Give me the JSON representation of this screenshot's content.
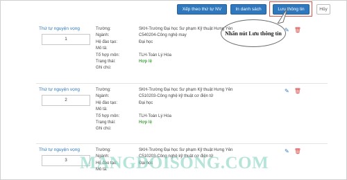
{
  "toolbar": {
    "sort_label": "Xếp theo thứ tự NV",
    "print_label": "In danh sách",
    "save_label": "Lưu thông tin",
    "cancel_label": "Hủy"
  },
  "callout": {
    "text": "Nhấn nút Lưu thông tin"
  },
  "field_labels": {
    "school": "Trường:",
    "major": "Ngành:",
    "training": "Hệ đào tạo:",
    "desc": "Mô tả:",
    "combo": "Tổ hợp môn:",
    "status": "Trạng thái:",
    "note": "Ghi chú:"
  },
  "rank_label": "Thứ tự nguyện vọng",
  "choices": [
    {
      "rank": "1",
      "school": "SKH-Trường Đại học Sư phạm Kỹ thuật Hưng Yên",
      "major": "C540204-Công nghệ may",
      "training": "Đại học",
      "combo": "TLH-Toán Lý Hóa",
      "status": "Hợp lệ"
    },
    {
      "rank": "2",
      "school": "SKH-Trường Đại học Sư phạm Kỹ thuật Hưng Yên",
      "major": "C510203-Công nghệ kỹ thuật cơ điện tử",
      "training": "Đại học",
      "combo": "TLH-Toán Lý Hóa",
      "status": "Hợp lệ"
    },
    {
      "rank": "3",
      "school": "SKH-Trường Đại học Sư phạm Kỹ thuật Hưng Yên",
      "major": "C510203-Công nghệ kỹ thuật cơ điện tử",
      "training": "Đại học"
    }
  ],
  "watermark": "MANGDOISONG.COM",
  "colors": {
    "primary": "#2f78bd",
    "danger": "#d64541",
    "valid": "#4fa64a",
    "highlight": "#d9534f"
  }
}
